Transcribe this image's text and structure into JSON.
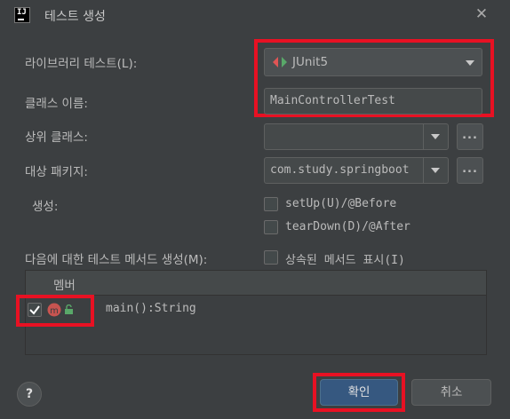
{
  "dialog": {
    "title": "테스트 생성"
  },
  "form": {
    "library_label": "라이브러리 테스트(L):",
    "library_value": "JUnit5",
    "class_name_label": "클래스 이름:",
    "class_name_value": "MainControllerTest",
    "superclass_label": "상위 클래스:",
    "superclass_value": "",
    "package_label": "대상 패키지:",
    "package_value": "com.study.springboot",
    "generate_label": "생성:",
    "setup_label": "setUp(U)/@Before",
    "setup_checked": false,
    "teardown_label": "tearDown(D)/@After",
    "teardown_checked": false,
    "methods_label": "다음에 대한 테스트 메서드 생성(M):",
    "show_inherited_label": "상속된 메서드 표시(I)",
    "show_inherited_checked": false,
    "ellipsis": "..."
  },
  "members": {
    "column_header": "멤버",
    "rows": [
      {
        "checked": true,
        "icon": "method-m-icon",
        "access": "public-lock-icon",
        "signature": "main():String"
      }
    ]
  },
  "footer": {
    "help": "?",
    "ok_label": "확인",
    "cancel_label": "취소"
  },
  "colors": {
    "background": "#3c3f41",
    "field": "#45494a",
    "primary_button": "#365880",
    "highlight": "#e81123",
    "method_icon": "#c75450",
    "check": "#ffffff"
  }
}
